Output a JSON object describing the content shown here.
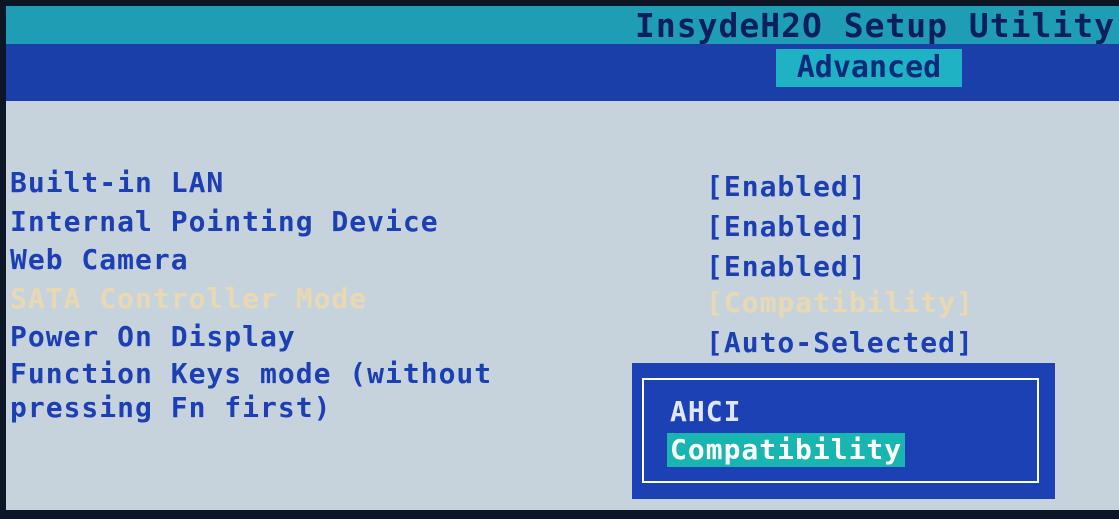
{
  "app_title": "InsydeH2O Setup Utility",
  "active_tab": "Advanced",
  "settings": [
    {
      "label": "Built-in LAN",
      "value": "[Enabled]"
    },
    {
      "label": "Internal Pointing Device",
      "value": "[Enabled]"
    },
    {
      "label": "Web Camera",
      "value": "[Enabled]"
    },
    {
      "label": "SATA Controller Mode",
      "value": "[Compatibility]"
    },
    {
      "label": "Power On Display",
      "value": "[Auto-Selected]"
    },
    {
      "label_line1": "Function Keys mode (without",
      "label_line2": "pressing Fn first)"
    }
  ],
  "popup": {
    "options": [
      "AHCI",
      "Compatibility"
    ],
    "selected": "Compatibility"
  },
  "colors": {
    "title_bar": "#1f9db5",
    "tab_bar": "#1a3fa8",
    "background": "#c7d3dc",
    "text": "#1c3fb3",
    "highlighted_item": "#e8d9b2",
    "popup_background": "#1c41b5",
    "popup_selection": "#19b5b1"
  }
}
